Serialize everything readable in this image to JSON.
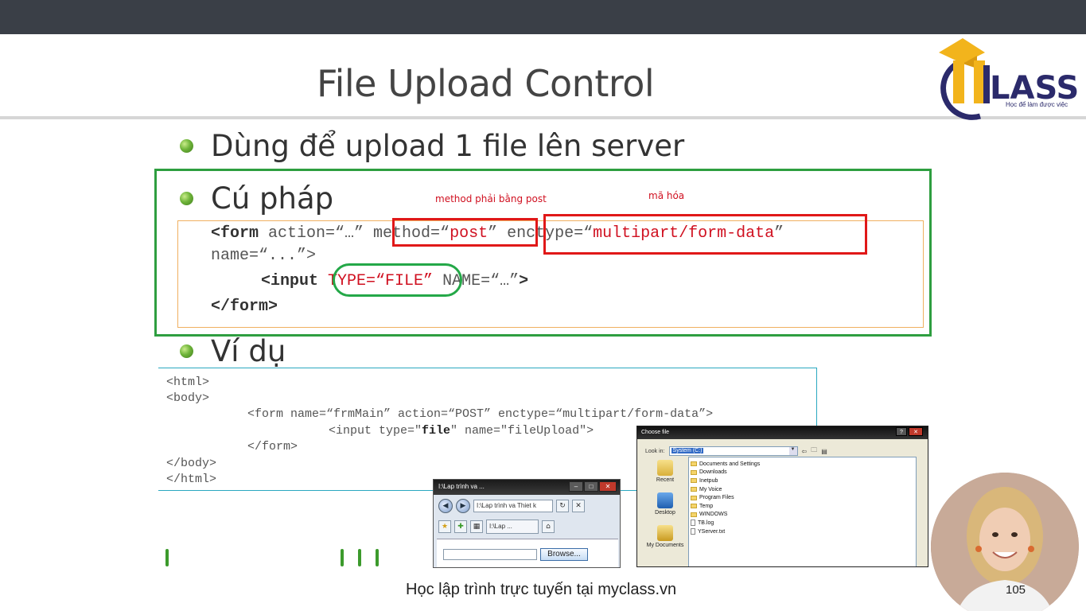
{
  "slide": {
    "title": "File Upload Control",
    "bullets": [
      "Dùng để upload 1 file lên server",
      "Cú pháp",
      "Ví dụ"
    ],
    "syntax": {
      "line1_tag": "<form",
      "line1_action": " action=“…” ",
      "line1_method_attr": "method=“",
      "line1_method_val": "post",
      "line1_method_close": "”",
      "line1_enctype_attr": " enctype=“",
      "line1_enctype_val": "multipart/form-data",
      "line1_enctype_close": "”",
      "line2": "name=“...”>",
      "line3_tag": "<input",
      "line3_type": "TYPE=“FILE”",
      "line3_name": " NAME=“…”",
      "line3_close": ">",
      "line4": "</form>"
    },
    "notes": {
      "method": "method phải bằng post",
      "encode": "mã hóa"
    },
    "example": {
      "l1": "<html>",
      "l2": "<body>",
      "l3": "<form name=“frmMain” action=“POST” enctype=“multipart/form-data”>",
      "l4a": "<input type=\"",
      "l4b": "file",
      "l4c": "\" name=\"fileUpload\">",
      "l5": "</form>",
      "l6": "</body>",
      "l7": "</html>"
    },
    "footer": "Học lập trình trực tuyến tại myclass.vn",
    "page_number": "105"
  },
  "logo": {
    "brand_text": "LASS",
    "tagline": "Học để làm được việc"
  },
  "browser": {
    "title": "I:\\Lap trình va ...",
    "address": "I:\\Lap trình va Thiet k",
    "tab": "I:\\Lap ...",
    "browse_button": "Browse..."
  },
  "dialog": {
    "title": "Choose file",
    "look_in_label": "Look in:",
    "look_in_value": "System (C:)",
    "places": [
      "Recent",
      "Desktop",
      "My Documents"
    ],
    "files": [
      {
        "name": "Documents and Settings",
        "kind": "folder"
      },
      {
        "name": "Downloads",
        "kind": "folder"
      },
      {
        "name": "Inetpub",
        "kind": "folder"
      },
      {
        "name": "My Voice",
        "kind": "folder"
      },
      {
        "name": "Program Files",
        "kind": "folder"
      },
      {
        "name": "Temp",
        "kind": "folder"
      },
      {
        "name": "WINDOWS",
        "kind": "folder"
      },
      {
        "name": "TB.log",
        "kind": "file"
      },
      {
        "name": "YServer.txt",
        "kind": "file"
      }
    ]
  },
  "colors": {
    "topbar": "#3a3f47",
    "highlight_red": "#e01818",
    "highlight_green": "#24a848",
    "frame_green": "#2e9e40",
    "code_red": "#d01020"
  }
}
